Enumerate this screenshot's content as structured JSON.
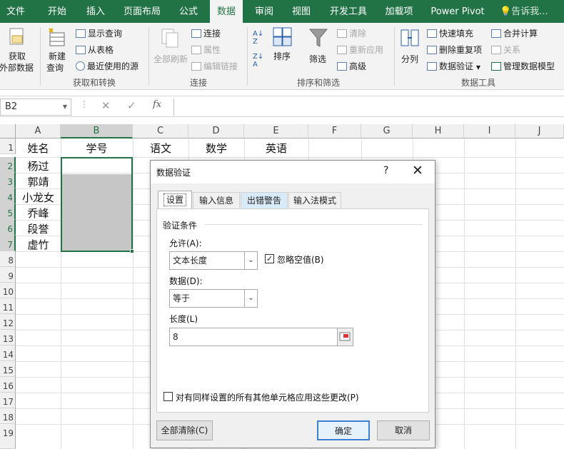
{
  "ribbon_tabs": [
    "文件",
    "开始",
    "插入",
    "页面布局",
    "公式",
    "数据",
    "审阅",
    "视图",
    "开发工具",
    "加载项",
    "Power Pivot"
  ],
  "active_tab": "数据",
  "tell_me": "告诉我...",
  "ribbon": {
    "get_external": [
      "获取",
      "外部数据"
    ],
    "new_query": [
      "新建",
      "查询"
    ],
    "show_queries": "显示查询",
    "from_table": "从表格",
    "recent_sources": "最近使用的源",
    "group_get_transform": "获取和转换",
    "refresh_all": "全部刷新",
    "connections": "连接",
    "properties": "属性",
    "edit_links": "编辑链接",
    "group_connections": "连接",
    "sort": "排序",
    "filter": "筛选",
    "clear": "清除",
    "reapply": "重新应用",
    "advanced": "高级",
    "group_sort_filter": "排序和筛选",
    "text_to_columns": "分列",
    "flash_fill": "快速填充",
    "remove_duplicates": "删除重复项",
    "data_validation": "数据验证",
    "consolidate": "合并计算",
    "relationships": "关系",
    "manage_data_model": "管理数据模型",
    "group_data_tools": "数据工具"
  },
  "formula_bar": {
    "name_box": "B2",
    "cancel": "✕",
    "enter": "✓",
    "fx": "fx",
    "content": ""
  },
  "columns": [
    "A",
    "B",
    "C",
    "D",
    "E",
    "F",
    "G",
    "H",
    "I",
    "J"
  ],
  "rows": [
    "1",
    "2",
    "3",
    "4",
    "5",
    "6",
    "7",
    "8",
    "9",
    "10",
    "11",
    "12",
    "13",
    "14",
    "15",
    "16",
    "17",
    "18",
    "19"
  ],
  "headers": {
    "A1": "姓名",
    "B1": "学号",
    "C1": "语文",
    "D1": "数学",
    "E1": "英语"
  },
  "names": [
    "杨过",
    "郭靖",
    "小龙女",
    "乔峰",
    "段誉",
    "虚竹"
  ],
  "dialog": {
    "title": "数据验证",
    "help": "?",
    "close": "✕",
    "tabs": [
      "设置",
      "输入信息",
      "出错警告",
      "输入法模式"
    ],
    "section": "验证条件",
    "allow_label": "允许(A):",
    "allow_value": "文本长度",
    "ignore_blank": "忽略空值(B)",
    "ignore_blank_checked": true,
    "data_label": "数据(D):",
    "data_value": "等于",
    "length_label": "长度(L)",
    "length_value": "8",
    "apply_all": "对有同样设置的所有其他单元格应用这些更改(P)",
    "clear_all": "全部清除(C)",
    "ok": "确定",
    "cancel": "取消"
  },
  "colors": {
    "excel_green": "#217346",
    "selection_fill": "#c6c6c6",
    "primary_button_border": "#3c7fd6"
  }
}
